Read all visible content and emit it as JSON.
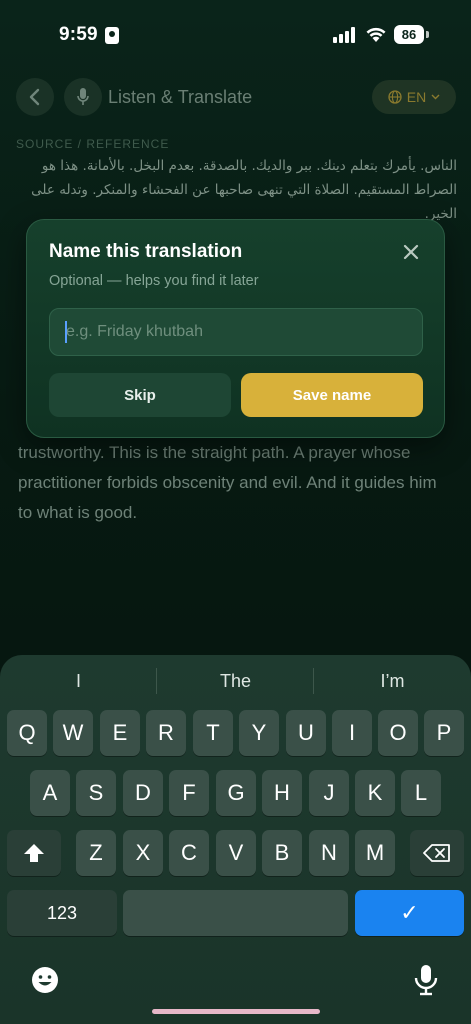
{
  "status_bar": {
    "time": "9:59",
    "battery": "86"
  },
  "app": {
    "title": "Listen & Translate",
    "language": "EN",
    "section_label": "SOURCE / REFERENCE",
    "arabic_text": "الناس. يأمرك بتعلم دينك. ببر والديك. بالصدقة. بعدم البخل. بالأمانة. هذا هو الصراط المستقيم. الصلاة التي تنهى صاحبها عن الفحشاء والمنكر. وتدله على الخير.",
    "translation_text": "trustworthy. This is the straight path. A prayer whose practitioner forbids obscenity and evil. And it guides him to what is good."
  },
  "modal": {
    "title": "Name this translation",
    "subtitle": "Optional — helps you find it later",
    "input_placeholder": "e.g. Friday khutbah",
    "input_value": "",
    "skip_label": "Skip",
    "save_label": "Save name"
  },
  "keyboard": {
    "suggestions": [
      "I",
      "The",
      "I’m"
    ],
    "row1": [
      "Q",
      "W",
      "E",
      "R",
      "T",
      "Y",
      "U",
      "I",
      "O",
      "P"
    ],
    "row2": [
      "A",
      "S",
      "D",
      "F",
      "G",
      "H",
      "J",
      "K",
      "L"
    ],
    "row3": [
      "Z",
      "X",
      "C",
      "V",
      "B",
      "N",
      "M"
    ],
    "numbers_label": "123",
    "return_label": "✓",
    "colors": {
      "return_key": "#1a83f0",
      "save_button": "#d8b13a"
    }
  }
}
